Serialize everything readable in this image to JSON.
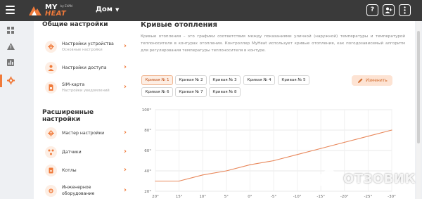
{
  "header": {
    "brand_top": "MY",
    "brand_bottom": "HEAT",
    "brand_by": "by EVAN",
    "home_label": "Дом",
    "help_icon_text": "?"
  },
  "rail": {
    "items": [
      {
        "icon": "dashboard-icon"
      },
      {
        "icon": "warning-icon"
      },
      {
        "icon": "chart-icon"
      },
      {
        "icon": "gear-icon",
        "active": true
      }
    ]
  },
  "settings": {
    "general_title": "Общие настройки",
    "general_items": [
      {
        "label": "Настройки устройства",
        "sub": "Основные настройки"
      },
      {
        "label": "Настройки доступа",
        "sub": ""
      },
      {
        "label": "SIM-карта",
        "sub": "Настройки уведомлений"
      }
    ],
    "advanced_title": "Расширенные настройки",
    "advanced_items": [
      {
        "label": "Мастер настройки"
      },
      {
        "label": "Датчики"
      },
      {
        "label": "Котлы"
      },
      {
        "label": "Инженерное",
        "label2": "оборудование"
      }
    ]
  },
  "main": {
    "title": "Кривые отопления",
    "description": "Кривые отопления – это графики соответствия между показаниями уличной (наружной) температуры и температурой теплоносителя в контурах отопления. Контроллер MyHeat использует кривые отопления, как погодозависимый алгоритм для регулирования температуры теплоносителя в контуре.",
    "tabs": [
      "Кривая № 1",
      "Кривая № 2",
      "Кривая № 3",
      "Кривая № 4",
      "Кривая № 5",
      "Кривая № 6",
      "Кривая № 7",
      "Кривая № 8"
    ],
    "active_tab": 0,
    "edit_label": "Изменить"
  },
  "watermark": {
    "text": "ОТЗОВИК"
  },
  "chart_data": {
    "type": "line",
    "x": [
      20,
      15,
      10,
      5,
      0,
      -5,
      -10,
      -15,
      -20,
      -25,
      -30
    ],
    "x_tick_labels": [
      "20°",
      "15°",
      "10°",
      "5°",
      "0°",
      "-5°",
      "-10°",
      "-15°",
      "-20°",
      "-25°",
      "-30°"
    ],
    "y_tick_labels": [
      "100°",
      "80°",
      "60°",
      "40°",
      "20°"
    ],
    "ylim": [
      20,
      100
    ],
    "xlim": [
      20,
      -30
    ],
    "series": [
      {
        "values": [
          30,
          30,
          36,
          40,
          46,
          50,
          56,
          62,
          68,
          74,
          80
        ],
        "color": "#e8875a"
      }
    ],
    "grid": true
  }
}
